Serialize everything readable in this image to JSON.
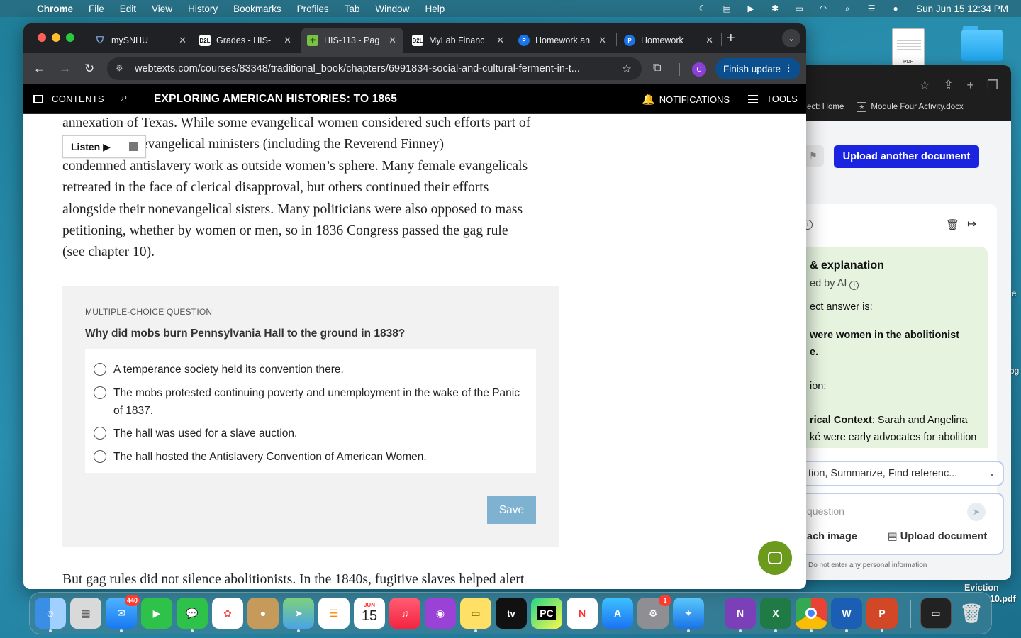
{
  "menubar": {
    "app": "Chrome",
    "items": [
      "File",
      "Edit",
      "View",
      "History",
      "Bookmarks",
      "Profiles",
      "Tab",
      "Window",
      "Help"
    ],
    "clock": "Sun Jun 15  12:34 PM"
  },
  "desktop": {
    "file_label": "PDF",
    "eviction_label_1": "Eviction",
    "eviction_label_2": "10.pdf",
    "edge_e": "e",
    "edge_pg": "pg"
  },
  "tabs": [
    {
      "title": "mySNHU",
      "icon": "shield"
    },
    {
      "title": "Grades - HIS-",
      "icon": "D2L"
    },
    {
      "title": "HIS-113 - Pag",
      "icon": "puzzle"
    },
    {
      "title": "MyLab Financ",
      "icon": "D2L"
    },
    {
      "title": "Homework an",
      "icon": "P"
    },
    {
      "title": "Homework",
      "icon": "P"
    }
  ],
  "omnibar": {
    "url": "webtexts.com/courses/83348/traditional_book/chapters/6991834-social-and-cultural-ferment-in-t...",
    "profile_initial": "C",
    "finish_update": "Finish update"
  },
  "sitebar": {
    "contents": "CONTENTS",
    "title": "EXPLORING AMERICAN HISTORIES: TO 1865",
    "notifications": "NOTIFICATIONS",
    "tools": "TOOLS"
  },
  "reading": {
    "lines": [
      "annexation of Texas. While some evangelical women considered such efforts part of",
      "              duty, evangelical ministers (including the Reverend Finney)",
      "condemned antislavery work as outside women’s sphere. Many female evangelicals",
      "retreated in the face of clerical disapproval, but others continued their efforts",
      "alongside their nonevangelical sisters. Many politicians were also opposed to mass",
      "petitioning, whether by women or men, so in 1836 Congress passed the gag rule",
      "(see chapter 10)."
    ],
    "listen_label": "Listen ▶",
    "next_paragraph": "But gag rules did not silence abolitionists. In the 1840s, fugitive slaves helped alert"
  },
  "question": {
    "kind": "MULTIPLE-CHOICE QUESTION",
    "text": "Why did mobs burn Pennsylvania Hall to the ground in 1838?",
    "options": [
      "A temperance society held its convention there.",
      "The mobs protested continuing poverty and unemployment in the wake of the Panic of 1837.",
      "The hall was used for a slave auction.",
      "The hall hosted the Antislavery Convention of American Women."
    ],
    "save": "Save"
  },
  "back_window": {
    "bookmark_1": "ect: Home",
    "bookmark_2": "Module Four Activity.docx",
    "upload_another": "Upload another document",
    "answer_heading": "& explanation",
    "answer_sub": "ed by AI",
    "answer_intro": "ect answer is:",
    "answer_bold_1": "were women in the abolitionist",
    "answer_bold_2": "e.",
    "explanation_label": "ion:",
    "context_bold": "rical Context",
    "context_text_1": ": Sarah and Angelina",
    "context_text_2": "ké were early advocates for abolition",
    "select_text": "tion, Summarize, Find referenc...",
    "input_placeholder": "question",
    "attach_image": "ach image",
    "upload_document": "Upload document",
    "note": "Do not enter any personal information"
  },
  "dock": {
    "mail_badge": "440",
    "calendar_month": "JUN",
    "calendar_day": "15",
    "settings_badge": "1",
    "tv_label": "tv",
    "pc_label": "PC"
  }
}
